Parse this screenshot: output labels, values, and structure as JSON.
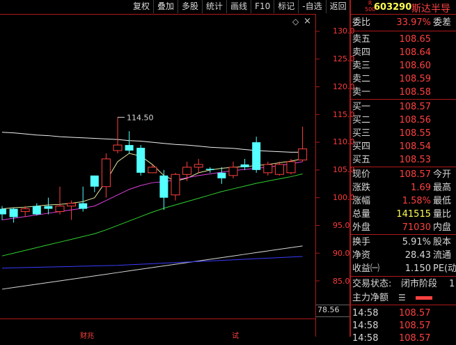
{
  "toolbar": {
    "items": [
      "复权",
      "叠加",
      "多股",
      "统计",
      "画线",
      "F10",
      "标记",
      "-自选",
      "返回"
    ]
  },
  "stock": {
    "code": "603290",
    "name": "斯达半导",
    "badge_top": "R",
    "badge_bottom": "500"
  },
  "ratio": {
    "label": "委比",
    "value": "33.97%",
    "tail": "委差"
  },
  "sell": [
    {
      "label": "卖五",
      "price": "108.65"
    },
    {
      "label": "卖四",
      "price": "108.64"
    },
    {
      "label": "卖三",
      "price": "108.60"
    },
    {
      "label": "卖二",
      "price": "108.59"
    },
    {
      "label": "卖一",
      "price": "108.58"
    }
  ],
  "buy": [
    {
      "label": "买一",
      "price": "108.57"
    },
    {
      "label": "买二",
      "price": "108.56"
    },
    {
      "label": "买三",
      "price": "108.55"
    },
    {
      "label": "买四",
      "price": "108.54"
    },
    {
      "label": "买五",
      "price": "108.53"
    }
  ],
  "quote": [
    {
      "label": "现价",
      "value": "108.57",
      "tail": "今开",
      "color": "#ff4040"
    },
    {
      "label": "涨跌",
      "value": "1.69",
      "tail": "最高",
      "color": "#ff4040"
    },
    {
      "label": "涨幅",
      "value": "1.58%",
      "tail": "最低",
      "color": "#ff4040"
    },
    {
      "label": "总量",
      "value": "141515",
      "tail": "量比",
      "color": "#ffff55"
    },
    {
      "label": "外盘",
      "value": "71030",
      "tail": "内盘",
      "color": "#ff4040"
    }
  ],
  "fund": [
    {
      "label": "换手",
      "value": "5.91%",
      "tail": "股本"
    },
    {
      "label": "净资",
      "value": "28.43",
      "tail": "流通"
    },
    {
      "label": "收益㈠",
      "value": "1.150",
      "tail": "PE(动"
    }
  ],
  "status": {
    "label": "交易状态:",
    "value": "闭市阶段",
    "tail": "1"
  },
  "main_force": {
    "label": "主力净额"
  },
  "trades": [
    {
      "time": "14:58",
      "price": "108.57"
    },
    {
      "time": "14:58",
      "price": "108.57"
    },
    {
      "time": "14:58",
      "price": "108.57"
    }
  ],
  "price_axis": {
    "ticks": [
      "130.0",
      "125.0",
      "120.0",
      "115.0",
      "110.0",
      "105.0",
      "100.0",
      "95.0",
      "90.0",
      "85.0"
    ]
  },
  "volume_axis_label": "78.56",
  "annotation_high": "114.50",
  "bottom_labels": {
    "left": "财兆",
    "mid": "试"
  },
  "chart_data": {
    "type": "candlestick",
    "y_ticks": [
      130,
      125,
      120,
      115,
      110,
      105,
      100,
      95,
      90,
      85
    ],
    "ylim": [
      81,
      133
    ],
    "candles": [
      {
        "o": 97.0,
        "c": 98.0,
        "h": 98.5,
        "l": 96.0,
        "up": false
      },
      {
        "o": 96.5,
        "c": 98.0,
        "h": 98.2,
        "l": 95.5,
        "up": false
      },
      {
        "o": 98.0,
        "c": 97.5,
        "h": 98.5,
        "l": 96.5,
        "up": true
      },
      {
        "o": 97.0,
        "c": 98.5,
        "h": 99.0,
        "l": 96.8,
        "up": false
      },
      {
        "o": 98.0,
        "c": 98.5,
        "h": 100.0,
        "l": 97.0,
        "up": false
      },
      {
        "o": 98.5,
        "c": 97.5,
        "h": 102.0,
        "l": 97.0,
        "up": true
      },
      {
        "o": 98.5,
        "c": 99.0,
        "h": 99.5,
        "l": 96.0,
        "up": true
      },
      {
        "o": 99.0,
        "c": 98.0,
        "h": 102.0,
        "l": 97.5,
        "up": false
      },
      {
        "o": 104.0,
        "c": 102.0,
        "h": 104.0,
        "l": 101.0,
        "up": false
      },
      {
        "o": 102.0,
        "c": 107.0,
        "h": 108.0,
        "l": 100.0,
        "up": true
      },
      {
        "o": 108.5,
        "c": 109.5,
        "h": 114.5,
        "l": 108.0,
        "up": true
      },
      {
        "o": 109.5,
        "c": 108.5,
        "h": 112.0,
        "l": 108.0,
        "up": false
      },
      {
        "o": 109.0,
        "c": 104.5,
        "h": 109.5,
        "l": 104.0,
        "up": false
      },
      {
        "o": 104.5,
        "c": 105.5,
        "h": 106.0,
        "l": 104.5,
        "up": true
      },
      {
        "o": 104.0,
        "c": 100.0,
        "h": 105.0,
        "l": 97.8,
        "up": false
      },
      {
        "o": 100.5,
        "c": 104.2,
        "h": 104.5,
        "l": 99.5,
        "up": true
      },
      {
        "o": 104.2,
        "c": 105.5,
        "h": 106.5,
        "l": 103.0,
        "up": true
      },
      {
        "o": 105.5,
        "c": 106.0,
        "h": 107.0,
        "l": 104.5,
        "up": true
      },
      {
        "o": 105.0,
        "c": 105.2,
        "h": 105.5,
        "l": 104.5,
        "up": false
      },
      {
        "o": 104.5,
        "c": 103.5,
        "h": 105.5,
        "l": 102.5,
        "up": false
      },
      {
        "o": 104.0,
        "c": 105.5,
        "h": 106.5,
        "l": 103.5,
        "up": true
      },
      {
        "o": 106.0,
        "c": 105.5,
        "h": 107.0,
        "l": 105.0,
        "up": false
      },
      {
        "o": 110.0,
        "c": 105.0,
        "h": 111.0,
        "l": 104.5,
        "up": false
      },
      {
        "o": 106.0,
        "c": 104.5,
        "h": 106.5,
        "l": 104.0,
        "up": true
      },
      {
        "o": 106.0,
        "c": 104.2,
        "h": 106.5,
        "l": 104.0,
        "up": true
      },
      {
        "o": 104.5,
        "c": 106.5,
        "h": 107.0,
        "l": 104.2,
        "up": true
      },
      {
        "o": 106.8,
        "c": 108.8,
        "h": 112.8,
        "l": 106.5,
        "up": true
      }
    ],
    "ma_lines": [
      {
        "color": "#f0f0f0",
        "values": [
          111.8,
          111.7,
          111.5,
          111.3,
          111.2,
          111.0,
          110.9,
          110.8,
          110.7,
          110.6,
          110.5,
          110.3,
          110.2,
          110.0,
          109.8,
          109.6,
          109.5,
          109.3,
          109.1,
          109.0,
          108.9,
          108.7,
          108.5,
          108.4,
          108.3,
          108.2,
          108.2
        ]
      },
      {
        "color": "#e6e6a0",
        "values": [
          98.0,
          98.2,
          98.3,
          98.5,
          98.7,
          98.8,
          99.0,
          99.3,
          100.0,
          103.0,
          106.5,
          108.0,
          107.5,
          106.0,
          104.0,
          103.0,
          103.5,
          104.5,
          105.0,
          105.3,
          105.5,
          105.6,
          105.8,
          106.0,
          106.3,
          106.6,
          107.0
        ]
      },
      {
        "color": "#e040e0",
        "values": [
          96.0,
          96.3,
          96.6,
          96.9,
          97.2,
          97.5,
          97.8,
          98.1,
          98.5,
          99.5,
          100.5,
          101.5,
          102.2,
          102.7,
          102.9,
          103.2,
          103.6,
          104.0,
          104.3,
          104.6,
          104.9,
          105.1,
          105.3,
          105.5,
          105.8,
          106.1,
          106.5
        ]
      },
      {
        "color": "#30d030",
        "values": [
          89.5,
          90.0,
          90.5,
          91.0,
          91.5,
          92.0,
          92.5,
          93.0,
          93.5,
          94.2,
          95.0,
          95.8,
          96.6,
          97.4,
          98.1,
          98.7,
          99.3,
          99.9,
          100.5,
          101.1,
          101.6,
          102.1,
          102.6,
          103.0,
          103.4,
          103.8,
          104.3
        ]
      },
      {
        "color": "#d8d8d8",
        "values": [
          83.5,
          83.8,
          84.1,
          84.4,
          84.7,
          85.0,
          85.3,
          85.6,
          85.9,
          86.2,
          86.5,
          86.8,
          87.1,
          87.4,
          87.7,
          88.0,
          88.3,
          88.6,
          88.9,
          89.2,
          89.5,
          89.8,
          90.1,
          90.4,
          90.7,
          91.0,
          91.3
        ]
      },
      {
        "color": "#3b3bff",
        "values": [
          87.3,
          87.35,
          87.4,
          87.45,
          87.5,
          87.55,
          87.6,
          87.65,
          87.7,
          87.75,
          87.8,
          87.9,
          88.0,
          88.1,
          88.2,
          88.3,
          88.4,
          88.5,
          88.6,
          88.7,
          88.8,
          88.9,
          89.0,
          89.1,
          89.2,
          89.3,
          89.4
        ]
      }
    ]
  }
}
